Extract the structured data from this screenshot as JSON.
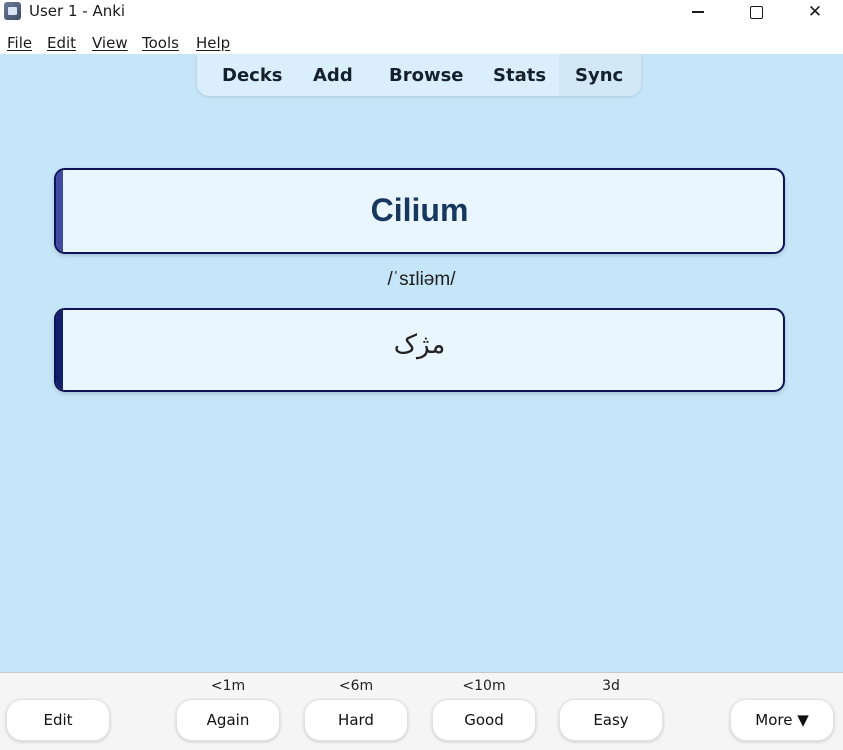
{
  "window": {
    "title": "User 1 - Anki",
    "icon": "anki-app-icon",
    "controls": [
      "minimize-icon",
      "maximize-icon",
      "close-icon"
    ],
    "close_glyph": "✕"
  },
  "menu": {
    "file": "File",
    "edit": "Edit",
    "view": "View",
    "tools": "Tools",
    "help": "Help"
  },
  "nav": {
    "decks": "Decks",
    "add": "Add",
    "browse": "Browse",
    "stats": "Stats",
    "sync": "Sync"
  },
  "card": {
    "front": "Cilium",
    "pronunciation": "/ˈsɪliəm/",
    "back": "مژک"
  },
  "bottom": {
    "edit": "Edit",
    "more": "More ▼",
    "answers": [
      {
        "interval": "<1m",
        "label": "Again"
      },
      {
        "interval": "<6m",
        "label": "Hard"
      },
      {
        "interval": "<10m",
        "label": "Good"
      },
      {
        "interval": "3d",
        "label": "Easy"
      }
    ]
  },
  "colors": {
    "background": "#c5e5f8",
    "card_background": "#eaf6ff",
    "card_border": "#0c1356",
    "front_text": "#17375e"
  }
}
